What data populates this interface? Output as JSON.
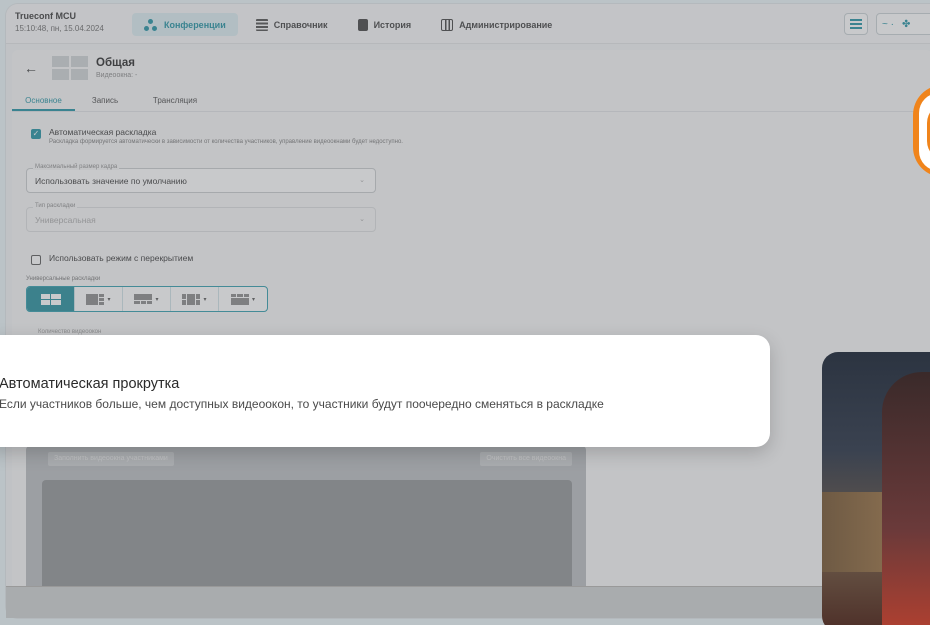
{
  "app": {
    "brand": "Trueconf MCU",
    "datetime": "15:10:48, пн, 15.04.2024"
  },
  "nav": {
    "conferences": "Конференции",
    "directory": "Справочник",
    "history": "История",
    "administration": "Администрирование"
  },
  "topbar_right": {
    "graph_label": "~ ·",
    "conf_label": "✤"
  },
  "page": {
    "back": "←",
    "title": "Общая",
    "subtitle": "Видеоокна: -"
  },
  "tabs": {
    "main": "Основное",
    "record": "Запись",
    "broadcast": "Трансляция"
  },
  "auto_layout": {
    "checked": true,
    "check_glyph": "✓",
    "label": "Автоматическая раскладка",
    "description": "Раскладка формируется автоматически в зависимости от количества участников, управление видеоокнами будет недоступно."
  },
  "max_frame": {
    "label": "Максимальный размер кадра",
    "value": "Использовать значение по умолчанию",
    "caret": "⌄"
  },
  "layout_type": {
    "label": "Тип раскладки",
    "value": "Универсальная",
    "caret": "⌄"
  },
  "overlap_mode": {
    "checked": false,
    "label": "Использовать режим с перекрытием"
  },
  "universal_layouts": {
    "label": "Универсальные раскладки",
    "caret": "▾"
  },
  "video_count": {
    "label": "Количество видеоокон"
  },
  "buttons": {
    "fill": "Заполнить видеоокна участниками",
    "clear": "Очистить все видеоокна"
  },
  "tooltip": {
    "title": "Автоматическая прокрутка",
    "body": "Если участников больше, чем доступных видеоокон, то участники будут поочередно сменяться в раскладке"
  },
  "colors": {
    "accent": "#1b8fa0",
    "orange": "#f0841b"
  }
}
